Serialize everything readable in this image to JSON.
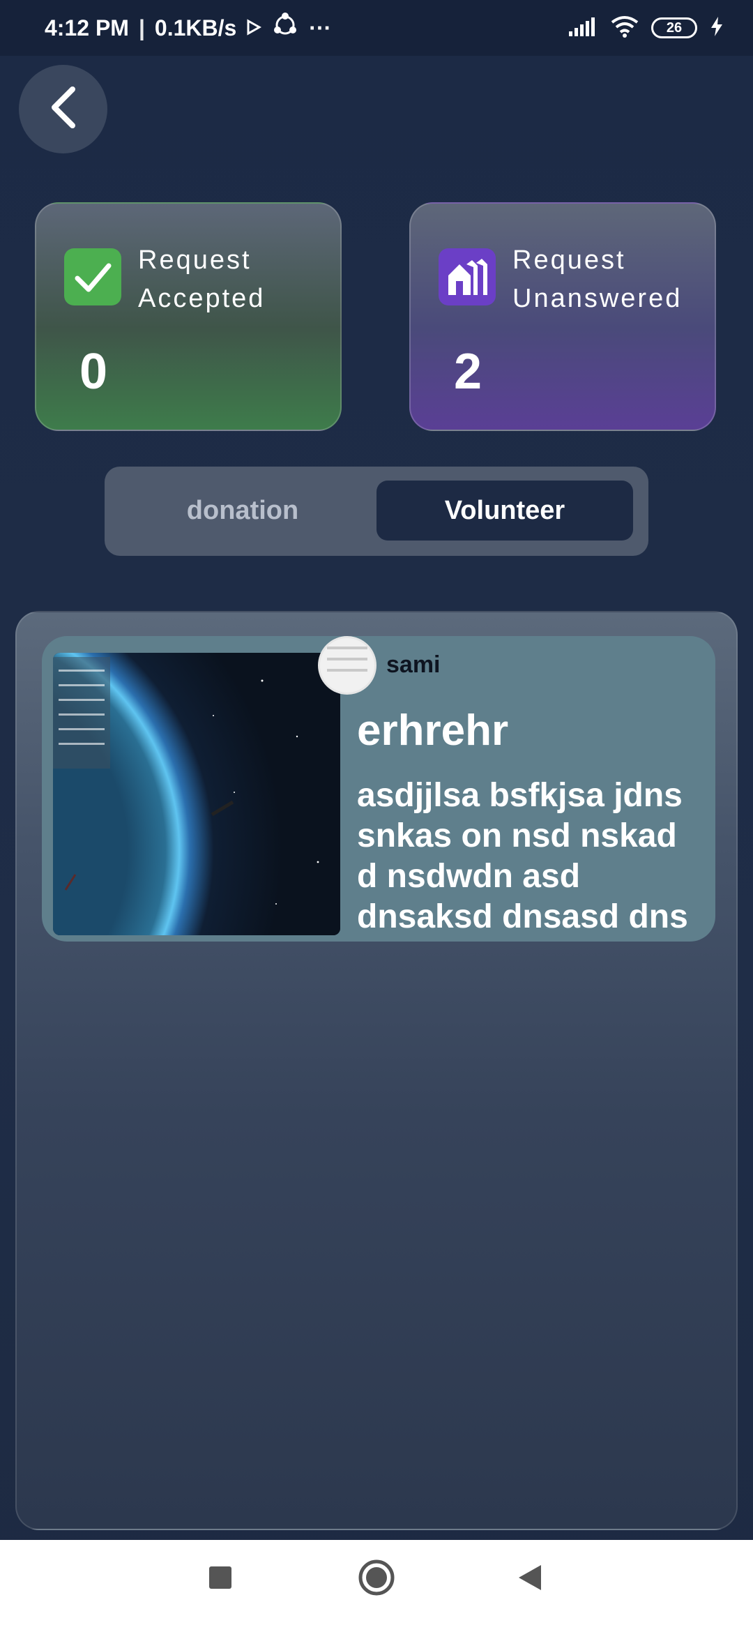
{
  "status_bar": {
    "time": "4:12 PM",
    "separator": "|",
    "speed": "0.1KB/s",
    "more": "···",
    "battery": "26"
  },
  "stats": {
    "accepted": {
      "label": "Request\nAccepted",
      "value": "0",
      "color": "#4caf50"
    },
    "unanswered": {
      "label": "Request\nUnanswered",
      "value": "2",
      "color": "#6b3fc6"
    }
  },
  "toggle": {
    "options": [
      "donation",
      "Volunteer"
    ],
    "selected": "Volunteer"
  },
  "items": [
    {
      "author": "sami",
      "title": "erhrehr",
      "description": "asdjjlsa bsfkjsa jdns snkas on nsd nskad d nsdwdn asd dnsaksd  dnsasd dns"
    }
  ]
}
